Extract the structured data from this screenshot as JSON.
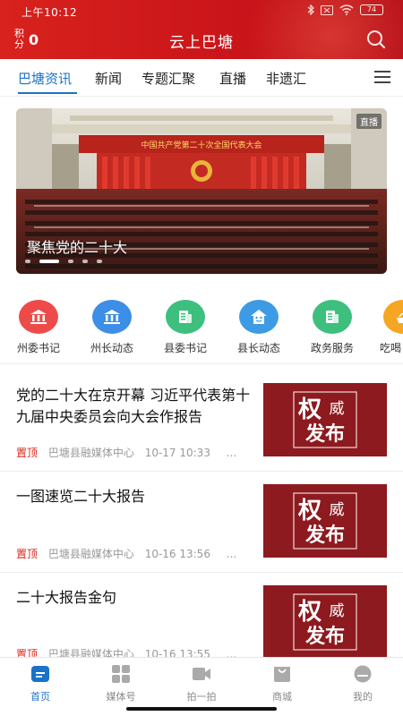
{
  "status_bar": {
    "time": "上午10:12",
    "battery": "74"
  },
  "header": {
    "points_label": "积分",
    "points_value": "0",
    "title": "云上巴塘"
  },
  "tabs": [
    {
      "label": "巴塘资讯",
      "active": true
    },
    {
      "label": "新闻",
      "active": false
    },
    {
      "label": "专题汇聚",
      "active": false
    },
    {
      "label": "直播",
      "active": false
    },
    {
      "label": "非遗汇",
      "active": false
    }
  ],
  "banner": {
    "caption": "聚焦党的二十大",
    "live_badge": "直播",
    "hall_banner": "中国共产党第二十次全国代表大会",
    "slide_count": 5,
    "active_slide": 2
  },
  "quick_links": [
    {
      "label": "州委书记",
      "color": "#ef4a4a",
      "icon": "government-building-icon"
    },
    {
      "label": "州长动态",
      "color": "#3d8ee6",
      "icon": "government-building-icon"
    },
    {
      "label": "县委书记",
      "color": "#3dbf7e",
      "icon": "document-icon"
    },
    {
      "label": "县长动态",
      "color": "#3d9be6",
      "icon": "person-house-icon"
    },
    {
      "label": "政务服务",
      "color": "#3dbf7e",
      "icon": "document-icon"
    },
    {
      "label": "吃喝",
      "color": "#f5a623",
      "icon": "food-icon"
    }
  ],
  "news": [
    {
      "title": "党的二十大在京开幕 习近平代表第十九届中央委员会向大会作报告",
      "tag": "置顶",
      "source": "巴塘县融媒体中心",
      "time": "10-17 10:33",
      "more": "...",
      "thumb": {
        "line1": "权",
        "line1b": "威",
        "line2": "发布"
      }
    },
    {
      "title": "一图速览二十大报告",
      "tag": "置顶",
      "source": "巴塘县融媒体中心",
      "time": "10-16 13:56",
      "more": "...",
      "thumb": {
        "line1": "权",
        "line1b": "威",
        "line2": "发布"
      }
    },
    {
      "title": "二十大报告金句",
      "tag": "置顶",
      "source": "巴塘县融媒体中心",
      "time": "10-16 13:55",
      "more": "...",
      "thumb": {
        "line1": "权",
        "line1b": "威",
        "line2": "发布"
      }
    }
  ],
  "bottom_nav": [
    {
      "label": "首页",
      "active": true,
      "icon": "home-icon"
    },
    {
      "label": "媒体号",
      "active": false,
      "icon": "grid-icon"
    },
    {
      "label": "拍一拍",
      "active": false,
      "icon": "video-camera-icon"
    },
    {
      "label": "商城",
      "active": false,
      "icon": "shopping-bag-icon"
    },
    {
      "label": "我的",
      "active": false,
      "icon": "profile-icon"
    }
  ],
  "colors": {
    "brand_red": "#d8221d",
    "accent_blue": "#1a73c8",
    "top_tag": "#d9281e"
  }
}
